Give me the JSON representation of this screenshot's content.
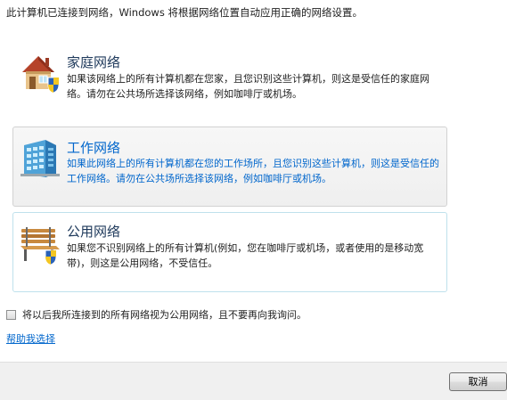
{
  "intro_text": "此计算机已连接到网络，Windows 将根据网络位置自动应用正确的网络设置。",
  "options": [
    {
      "title": "家庭网络",
      "description": "如果该网络上的所有计算机都在您家，且您识别这些计算机，则这是受信任的家庭网络。请勿在公共场所选择该网络，例如咖啡厅或机场。",
      "icon": "house-shield-icon"
    },
    {
      "title": "工作网络",
      "description": "如果此网络上的所有计算机都在您的工作场所，且您识别这些计算机，则这是受信任的工作网络。请勿在公共场所选择该网络，例如咖啡厅或机场。",
      "icon": "office-building-icon",
      "highlighted": true
    },
    {
      "title": "公用网络",
      "description": "如果您不识别网络上的所有计算机(例如，您在咖啡厅或机场，或者使用的是移动宽带)，则这是公用网络，不受信任。",
      "icon": "park-bench-shield-icon"
    }
  ],
  "checkbox": {
    "label": "将以后我所连接到的所有网络视为公用网络，且不要再向我询问。",
    "checked": false
  },
  "help_link": "帮助我选择",
  "footer": {
    "cancel_label": "取消"
  },
  "colors": {
    "link": "#0066cc",
    "title": "#1e395b",
    "footer_bg": "#f0f0f0",
    "public_border": "#bfe1ec"
  }
}
